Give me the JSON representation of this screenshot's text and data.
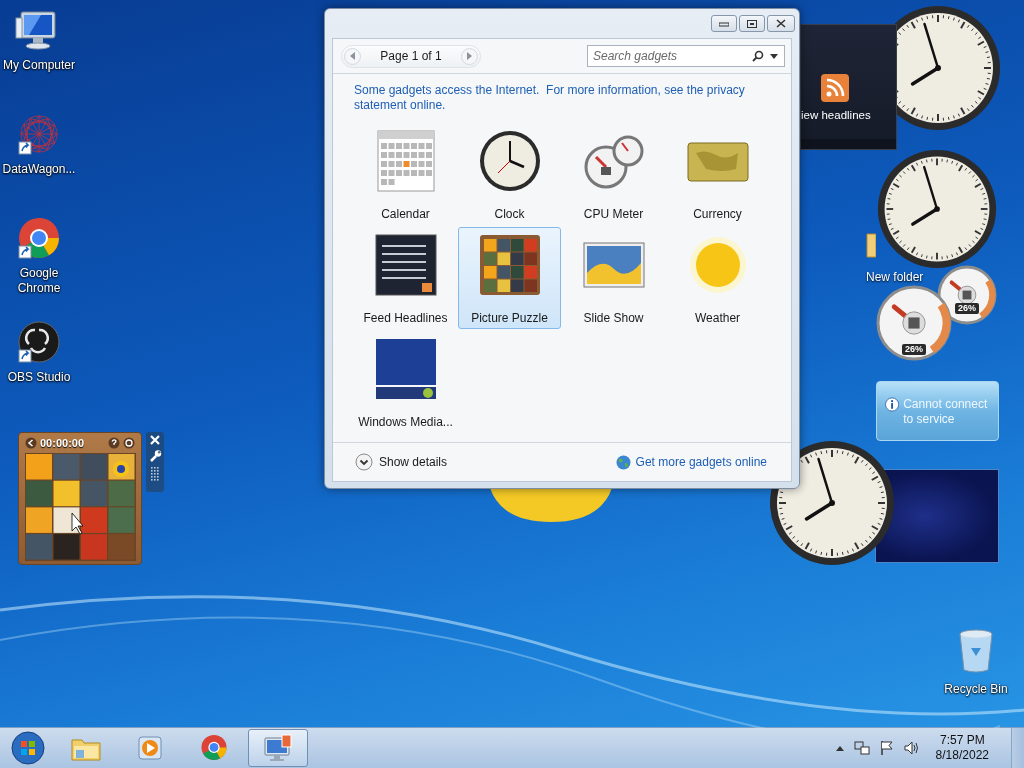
{
  "desktop_icons": [
    {
      "kind": "computer",
      "label": "My Computer",
      "shortcut": false
    },
    {
      "kind": "web",
      "label": "DataWagon...",
      "shortcut": true
    },
    {
      "kind": "chrome",
      "label": "Google Chrome",
      "shortcut": true
    },
    {
      "kind": "obs",
      "label": "OBS Studio",
      "shortcut": true
    }
  ],
  "gadget_gallery": {
    "pager": {
      "text": "Page 1 of 1"
    },
    "search": {
      "placeholder": "Search gadgets"
    },
    "notice": "Some gadgets access the Internet.  For more information, see the privacy statement online.",
    "gadgets": [
      {
        "kind": "calendar",
        "name": "Calendar",
        "selected": false
      },
      {
        "kind": "clock",
        "name": "Clock",
        "selected": false
      },
      {
        "kind": "cpu",
        "name": "CPU Meter",
        "selected": false
      },
      {
        "kind": "currency",
        "name": "Currency",
        "selected": false
      },
      {
        "kind": "feed",
        "name": "Feed Headlines",
        "selected": false
      },
      {
        "kind": "puzzle",
        "name": "Picture Puzzle",
        "selected": true
      },
      {
        "kind": "slideshow",
        "name": "Slide Show",
        "selected": false
      },
      {
        "kind": "weather",
        "name": "Weather",
        "selected": false
      },
      {
        "kind": "media",
        "name": "Windows Media...",
        "selected": false
      }
    ],
    "show_details": "Show details",
    "get_more": "Get more gadgets online"
  },
  "puzzle_gadget": {
    "timer": "00:00:00"
  },
  "feed_gadget": {
    "text": "iew headlines"
  },
  "new_folder": {
    "label": "New folder"
  },
  "cpu_meter": {
    "readings": [
      "26%",
      "26%"
    ]
  },
  "weather_gadget": {
    "message": "Cannot connect to service"
  },
  "recycle_bin": {
    "label": "Recycle Bin"
  },
  "taskbar": {
    "buttons": [
      {
        "kind": "explorer",
        "selected": false
      },
      {
        "kind": "media-player",
        "selected": false
      },
      {
        "kind": "chrome",
        "selected": false
      },
      {
        "kind": "control-panel",
        "selected": true
      }
    ],
    "clock": {
      "time": "7:57 PM",
      "date": "8/18/2022"
    }
  }
}
